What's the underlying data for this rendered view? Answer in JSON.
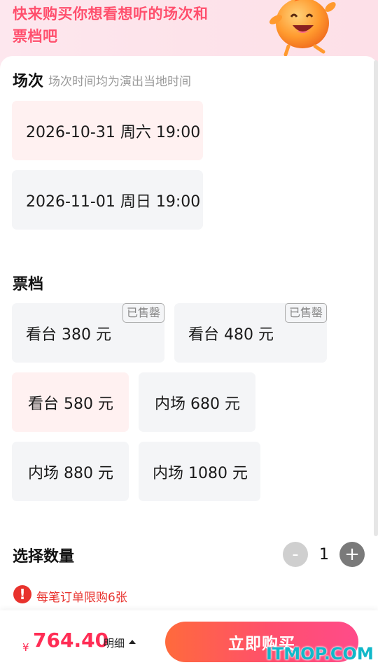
{
  "banner": {
    "title": "快来购买你想看想听的场次和票档吧"
  },
  "session_section": {
    "title": "场次",
    "subtitle": "场次时间均为演出当地时间",
    "options": [
      {
        "label": "2026-10-31 周六 19:00",
        "selected": true
      },
      {
        "label": "2026-11-01 周日 19:00",
        "selected": false
      }
    ]
  },
  "ticket_section": {
    "title": "票档",
    "sold_out_label": "已售罄",
    "options": [
      {
        "label": "看台 380 元",
        "sold_out": true,
        "selected": false
      },
      {
        "label": "看台 480 元",
        "sold_out": true,
        "selected": false
      },
      {
        "label": "看台 580 元",
        "sold_out": false,
        "selected": true
      },
      {
        "label": "内场 680 元",
        "sold_out": false,
        "selected": false
      },
      {
        "label": "内场 880 元",
        "sold_out": false,
        "selected": false
      },
      {
        "label": "内场 1080 元",
        "sold_out": false,
        "selected": false
      }
    ]
  },
  "quantity_section": {
    "title": "选择数量",
    "minus": "-",
    "value": "1",
    "plus": "+"
  },
  "notice": {
    "icon": "!",
    "text": "每笔订单限购6张"
  },
  "bottom_bar": {
    "currency": "¥",
    "price": "764.40",
    "detail_label": "明细",
    "buy_label": "立即购买"
  },
  "watermark": "ITMOP.COM",
  "colors": {
    "accent": "#ff2d55",
    "banner_text": "#ff4f6d",
    "selected_bg": "#fff1f1",
    "card_bg": "#f4f5f7",
    "notice": "#e8322d"
  }
}
